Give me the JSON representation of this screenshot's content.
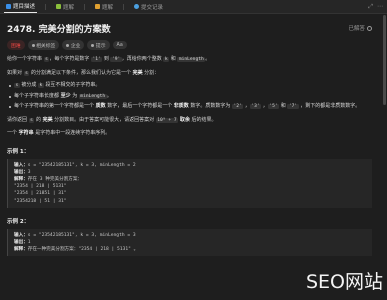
{
  "tabs": [
    {
      "label": "题目描述",
      "icon": "doc-icon"
    },
    {
      "label": "题解",
      "icon": "flask-icon"
    },
    {
      "label": "题解",
      "icon": "book-icon"
    },
    {
      "label": "提交记录",
      "icon": "clock-icon"
    }
  ],
  "window_controls": [
    "⤢",
    "⋯"
  ],
  "problem": {
    "title": "2478. 完美分割的方案数",
    "status": "已解答",
    "tags": {
      "difficulty": "困难",
      "related": "相关标签",
      "company": "企业",
      "hint": "提示",
      "font": "Aa"
    },
    "intro": {
      "t1": "给你一个字符串 ",
      "c1": "s",
      "t2": "，每个字符是数字 ",
      "c2": "'1'",
      "t3": " 到 ",
      "c3": "'9'",
      "t4": "，再给你两个整数 ",
      "c4": "k",
      "t5": " 和 ",
      "c5": "minLength",
      "t6": "。"
    },
    "def": {
      "t1": "如果对 ",
      "c1": "s",
      "t2": " 的分割满足以下条件，那么我们认为它是一个 ",
      "b1": "完美",
      "t3": " 分割："
    },
    "bullets": {
      "b1": {
        "c1": "s",
        "t1": " 被分成 ",
        "c2": "k",
        "t2": " 段互不相交的子字符串。"
      },
      "b2": {
        "t1": "每个子字符串长度都 ",
        "b1": "至少",
        "t2": " 为 ",
        "c1": "minLength",
        "t3": "。"
      },
      "b3": {
        "t1": "每个子字符串的第一个字符都是一个 ",
        "b1": "质数",
        "t2": " 数字，最后一个字符都是一个 ",
        "b2": "非质数",
        "t3": " 数字。质数数字为 ",
        "c1": "'2'",
        "t4": " ，",
        "c2": "'3'",
        "t5": " ，",
        "c3": "'5'",
        "t6": " 和 ",
        "c4": "'7'",
        "t7": " ，剩下的都是非质数数字。"
      }
    },
    "ret": {
      "t1": "请你返回 ",
      "c1": "s",
      "t2": " 的 ",
      "b1": "完美",
      "t3": " 分割数目。由于答案可能很大，请返回答案对 ",
      "c2": "10⁹ + 7",
      "t4": " 取余",
      "t5": " 后的结果。"
    },
    "sub": {
      "t1": "一个 ",
      "b1": "字符串",
      "t2": " 是字符串中一段连续字符串序列。"
    }
  },
  "examples": [
    {
      "title": "示例 1：",
      "input_label": "输入：",
      "input": "s = \"23542185131\", k = 3, minLength = 2",
      "output_label": "输出：",
      "output": "3",
      "expl_label": "解释：",
      "expl_lines": [
        "存在 3 种完美分割方案：",
        "\"2354 | 218 | 5131\"",
        "\"2354 | 21851 | 31\"",
        "\"2354218 | 51 | 31\""
      ]
    },
    {
      "title": "示例 2：",
      "input_label": "输入：",
      "input": "s = \"23542185131\", k = 3, minLength = 3",
      "output_label": "输出：",
      "output": "1",
      "expl_label": "解释：",
      "expl_lines": [
        "存在一种完美分割方案：\"2354 | 218 | 5131\" 。"
      ]
    }
  ],
  "watermark": "SEO网站"
}
